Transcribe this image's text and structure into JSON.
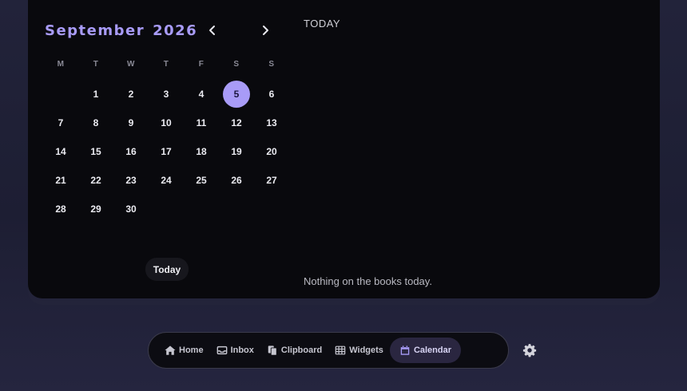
{
  "calendar": {
    "month": "September",
    "year": "2026",
    "weekdays": [
      "M",
      "T",
      "W",
      "T",
      "F",
      "S",
      "S"
    ],
    "leading_blanks": 1,
    "days": [
      "1",
      "2",
      "3",
      "4",
      "5",
      "6",
      "7",
      "8",
      "9",
      "10",
      "11",
      "12",
      "13",
      "14",
      "15",
      "16",
      "17",
      "18",
      "19",
      "20",
      "21",
      "22",
      "23",
      "24",
      "25",
      "26",
      "27",
      "28",
      "29",
      "30"
    ],
    "selected_day": "5",
    "today_button": "Today"
  },
  "agenda": {
    "heading": "TODAY",
    "empty_message": "Nothing on the books today."
  },
  "dock": {
    "items": [
      {
        "label": "Home",
        "icon": "home-icon"
      },
      {
        "label": "Inbox",
        "icon": "inbox-icon"
      },
      {
        "label": "Clipboard",
        "icon": "clipboard-icon"
      },
      {
        "label": "Widgets",
        "icon": "table-icon"
      },
      {
        "label": "Calendar",
        "icon": "calendar-icon",
        "active": true
      }
    ],
    "settings_icon": "gear-icon"
  },
  "colors": {
    "accent": "#a89bf7",
    "panel": "#09090d",
    "background": "#1f2036"
  }
}
